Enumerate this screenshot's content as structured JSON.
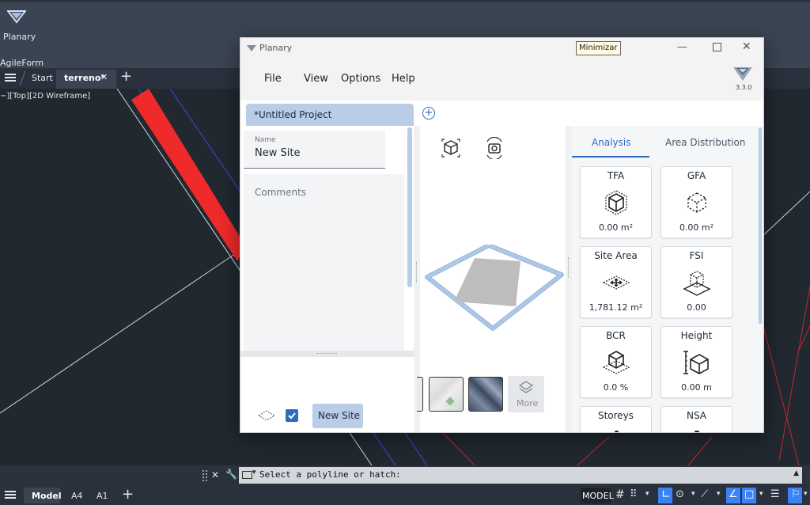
{
  "host": {
    "app_label": "Planary",
    "ribbon_panel_label": "AgileForm",
    "tabs": [
      "Start",
      "terreno*"
    ],
    "viewport_label": "−][Top][2D Wireframe]",
    "command_prompt": "Select a polyline or hatch:",
    "layout_tabs": [
      "Model",
      "A4",
      "A1"
    ],
    "status_model": "MODEL"
  },
  "window": {
    "title": "Planary",
    "tooltip": "Minimizar",
    "version": "3.3.0",
    "menu": [
      "File",
      "View",
      "Options",
      "Help"
    ],
    "project_tab": "*Untitled Project"
  },
  "site": {
    "name_label": "Name",
    "name_value": "New Site",
    "comments_placeholder": "Comments",
    "site_button": "New Site"
  },
  "viewer": {
    "more_label": "More"
  },
  "analysis": {
    "tabs": [
      "Analysis",
      "Area Distribution"
    ],
    "cards": [
      {
        "title": "TFA",
        "value": "0.00 m²"
      },
      {
        "title": "GFA",
        "value": "0.00 m²"
      },
      {
        "title": "Site Area",
        "value": "1,781.12 m²"
      },
      {
        "title": "FSI",
        "value": "0.00"
      },
      {
        "title": "BCR",
        "value": "0.0 %"
      },
      {
        "title": "Height",
        "value": "0.00 m"
      },
      {
        "title": "Storeys",
        "value": ""
      },
      {
        "title": "NSA",
        "value": ""
      }
    ]
  },
  "colors": {
    "accent": "#2f6bbf",
    "tab_active": "#b9cce8",
    "host_bg": "#222831"
  }
}
